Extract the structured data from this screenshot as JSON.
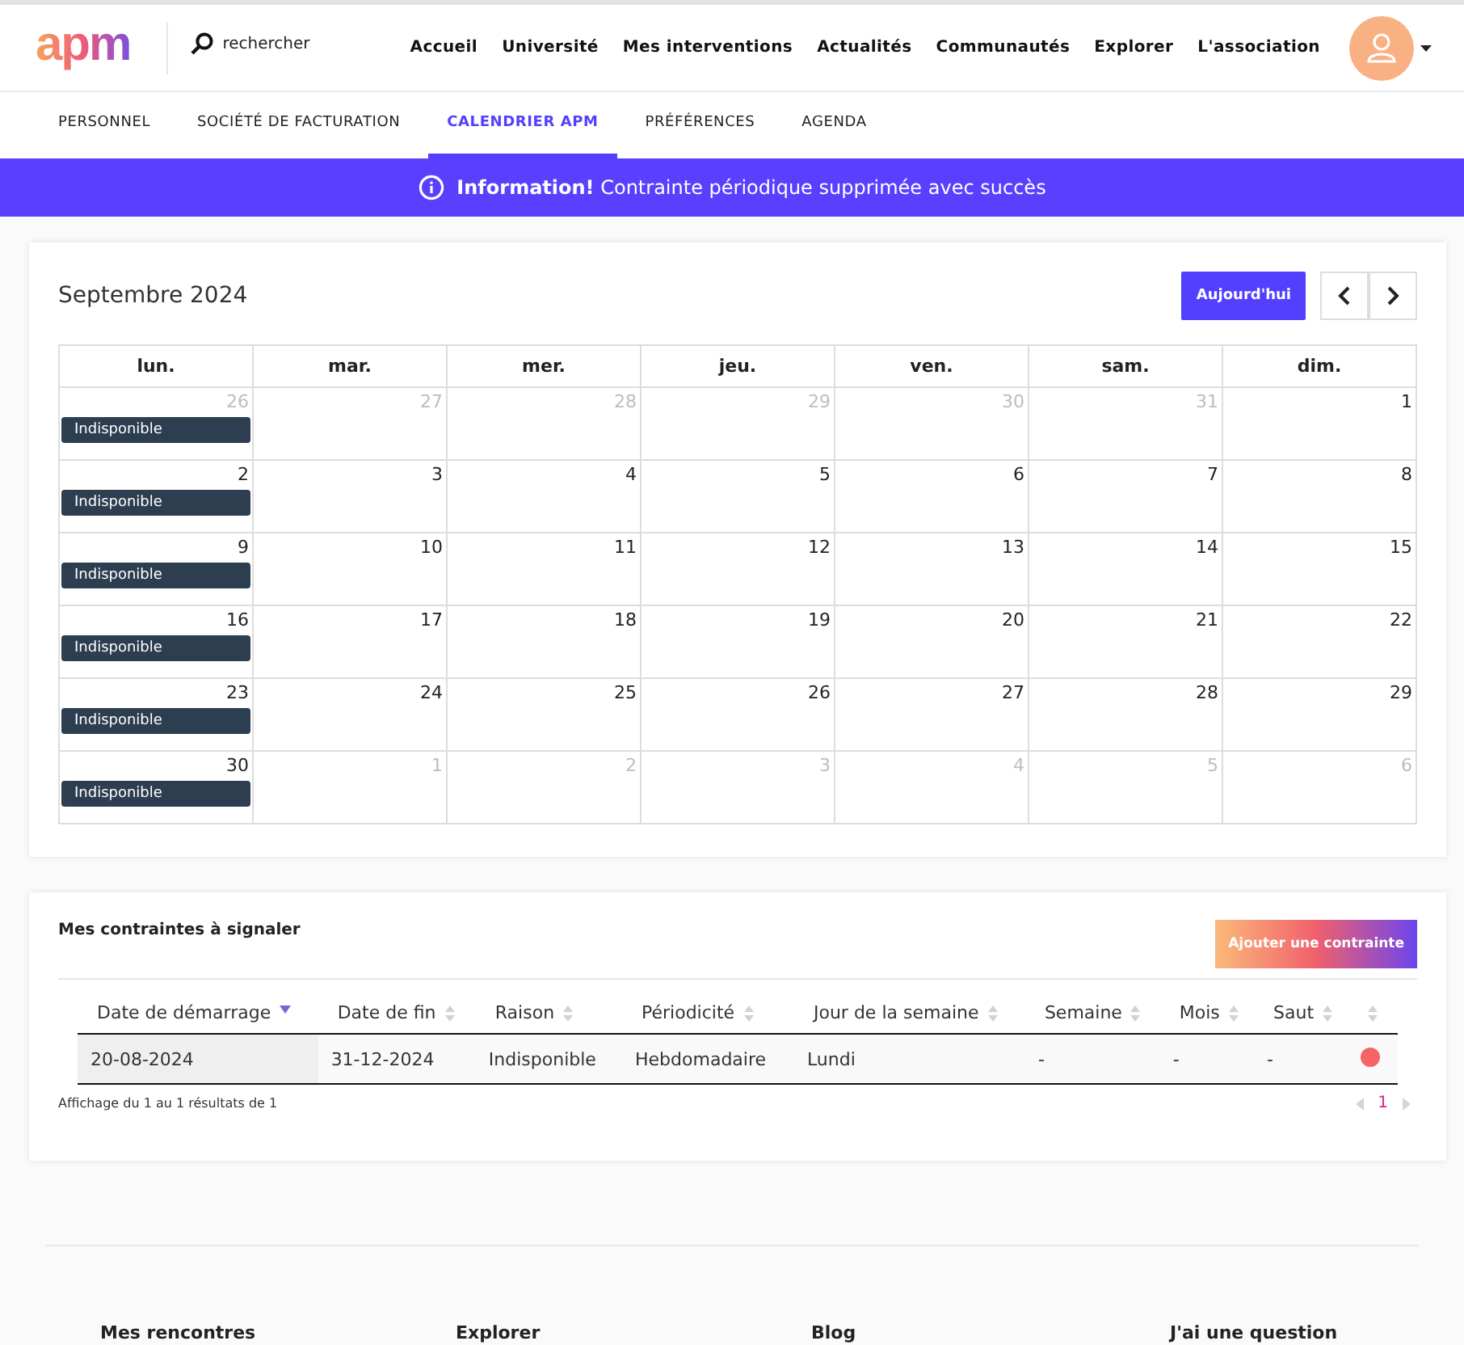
{
  "header": {
    "logo": "apm",
    "search": {
      "placeholder": "rechercher"
    },
    "nav": [
      "Accueil",
      "Université",
      "Mes interventions",
      "Actualités",
      "Communautés",
      "Explorer",
      "L'association"
    ]
  },
  "tabs": [
    {
      "label": "PERSONNEL",
      "selected": false
    },
    {
      "label": "SOCIÉTÉ DE FACTURATION",
      "selected": false
    },
    {
      "label": "CALENDRIER APM",
      "selected": true
    },
    {
      "label": "PRÉFÉRENCES",
      "selected": false
    },
    {
      "label": "AGENDA",
      "selected": false
    }
  ],
  "alert": {
    "title": "Information!",
    "message": "Contrainte périodique supprimée avec succès"
  },
  "calendar": {
    "title": "Septembre 2024",
    "today_button": "Aujourd'hui",
    "weekdays": [
      "lun.",
      "mar.",
      "mer.",
      "jeu.",
      "ven.",
      "sam.",
      "dim."
    ],
    "weeks": [
      [
        {
          "day": "26",
          "other_month": true,
          "event": "Indisponible"
        },
        {
          "day": "27",
          "other_month": true
        },
        {
          "day": "28",
          "other_month": true
        },
        {
          "day": "29",
          "other_month": true
        },
        {
          "day": "30",
          "other_month": true
        },
        {
          "day": "31",
          "other_month": true
        },
        {
          "day": "1",
          "other_month": false
        }
      ],
      [
        {
          "day": "2",
          "other_month": false,
          "event": "Indisponible"
        },
        {
          "day": "3",
          "other_month": false
        },
        {
          "day": "4",
          "other_month": false
        },
        {
          "day": "5",
          "other_month": false
        },
        {
          "day": "6",
          "other_month": false
        },
        {
          "day": "7",
          "other_month": false
        },
        {
          "day": "8",
          "other_month": false
        }
      ],
      [
        {
          "day": "9",
          "other_month": false,
          "event": "Indisponible"
        },
        {
          "day": "10",
          "other_month": false
        },
        {
          "day": "11",
          "other_month": false
        },
        {
          "day": "12",
          "other_month": false
        },
        {
          "day": "13",
          "other_month": false
        },
        {
          "day": "14",
          "other_month": false
        },
        {
          "day": "15",
          "other_month": false
        }
      ],
      [
        {
          "day": "16",
          "other_month": false,
          "event": "Indisponible"
        },
        {
          "day": "17",
          "other_month": false
        },
        {
          "day": "18",
          "other_month": false
        },
        {
          "day": "19",
          "other_month": false
        },
        {
          "day": "20",
          "other_month": false
        },
        {
          "day": "21",
          "other_month": false
        },
        {
          "day": "22",
          "other_month": false
        }
      ],
      [
        {
          "day": "23",
          "other_month": false,
          "event": "Indisponible"
        },
        {
          "day": "24",
          "other_month": false
        },
        {
          "day": "25",
          "other_month": false
        },
        {
          "day": "26",
          "other_month": false
        },
        {
          "day": "27",
          "other_month": false
        },
        {
          "day": "28",
          "other_month": false
        },
        {
          "day": "29",
          "other_month": false
        }
      ],
      [
        {
          "day": "30",
          "other_month": false,
          "event": "Indisponible"
        },
        {
          "day": "1",
          "other_month": true
        },
        {
          "day": "2",
          "other_month": true
        },
        {
          "day": "3",
          "other_month": true
        },
        {
          "day": "4",
          "other_month": true
        },
        {
          "day": "5",
          "other_month": true
        },
        {
          "day": "6",
          "other_month": true
        }
      ]
    ]
  },
  "constraints": {
    "title": "Mes contraintes à signaler",
    "add_button": "Ajouter une contrainte",
    "columns": [
      {
        "label": "Date de démarrage",
        "sorted": true
      },
      {
        "label": "Date de fin",
        "sorted": false
      },
      {
        "label": "Raison",
        "sorted": false
      },
      {
        "label": "Périodicité",
        "sorted": false
      },
      {
        "label": "Jour de la semaine",
        "sorted": false
      },
      {
        "label": "Semaine",
        "sorted": false
      },
      {
        "label": "Mois",
        "sorted": false
      },
      {
        "label": "Saut",
        "sorted": false
      },
      {
        "sorted": false
      }
    ],
    "rows": [
      {
        "cells": [
          "20-08-2024",
          "31-12-2024",
          "Indisponible",
          "Hebdomadaire",
          "Lundi",
          "-",
          "-",
          "-"
        ],
        "color": "#f56565"
      }
    ],
    "summary": "Affichage du 1 au 1 résultats de 1",
    "pages": [
      {
        "label": "1",
        "selected": true
      }
    ]
  },
  "footer": {
    "headings": [
      "Mes rencontres",
      "Explorer",
      "Blog",
      "J'ai une question"
    ]
  }
}
